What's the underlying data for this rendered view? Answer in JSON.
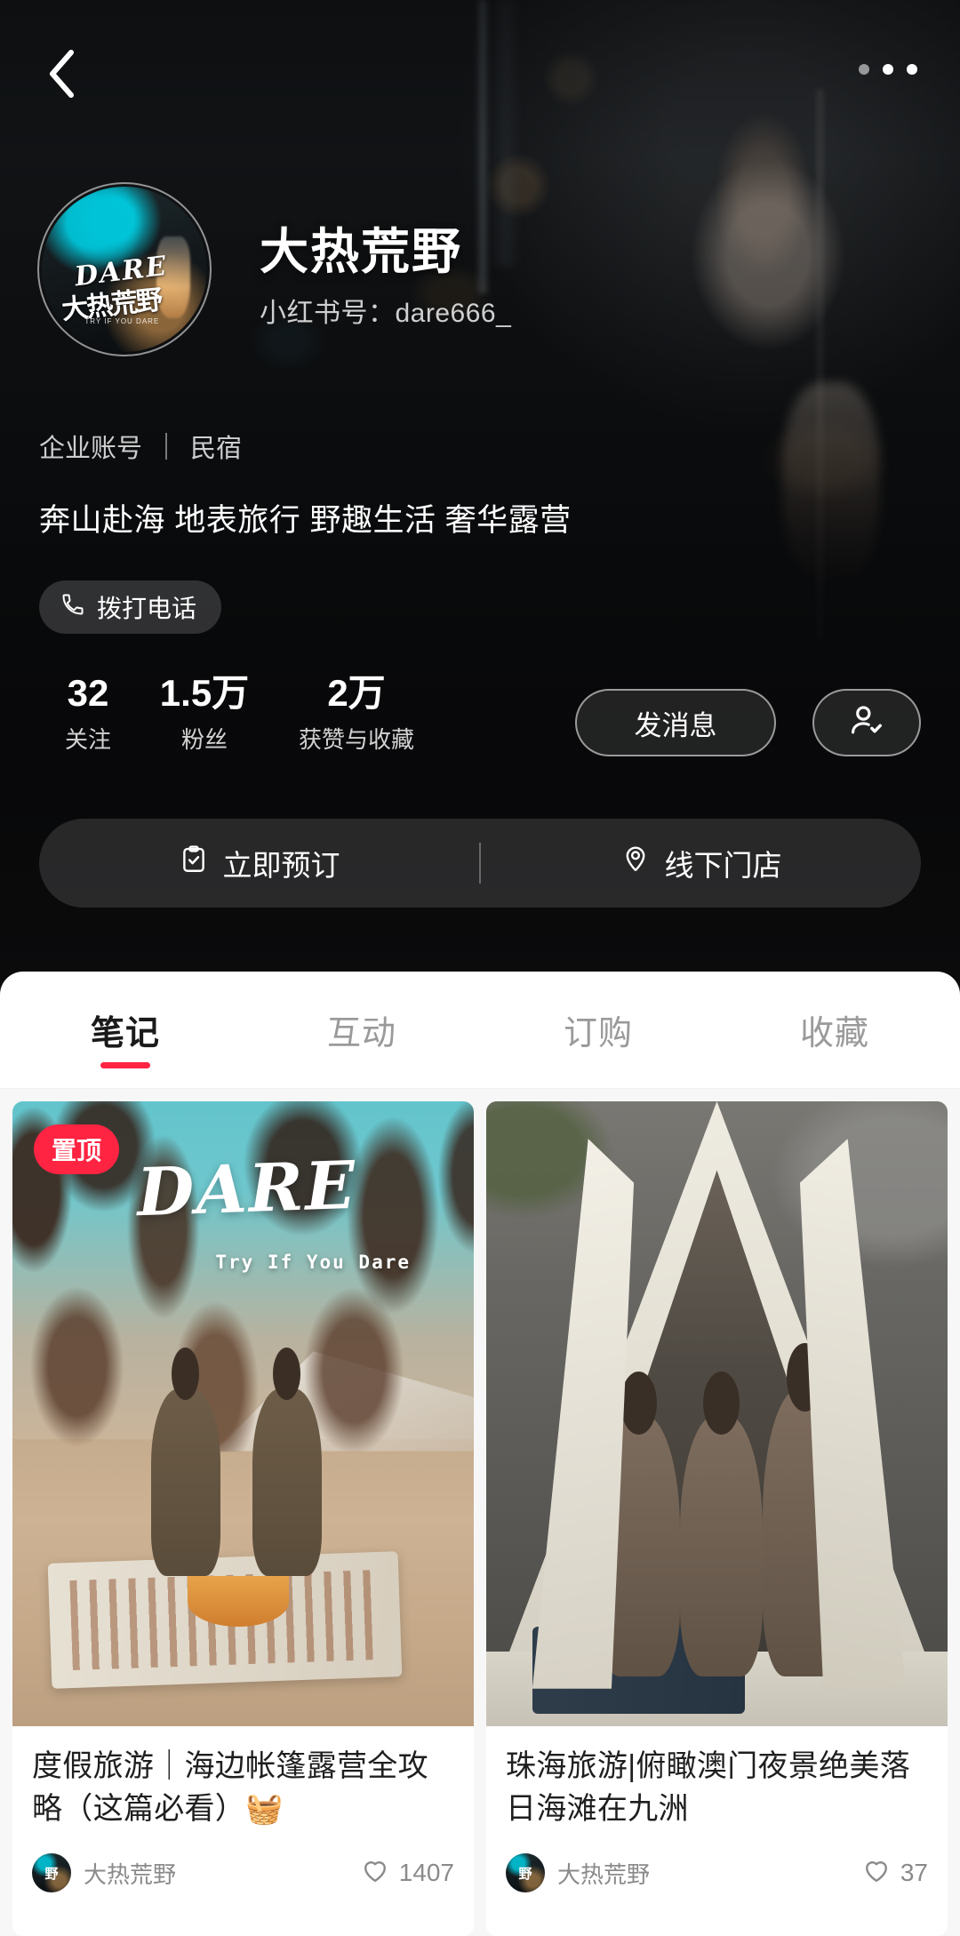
{
  "topbar": {
    "back_icon": "chevron-left-icon",
    "more_icon": "more-dots-icon"
  },
  "profile": {
    "avatar_alt": "DARE 大热荒野 logo",
    "avatar_logo_en": "DARE",
    "avatar_logo_cn": "大热荒野",
    "avatar_logo_tag": "TRY IF YOU DARE",
    "name": "大热荒野",
    "rednote_id_label": "小红书号：",
    "rednote_id_value": "dare666_",
    "account_type": "企业账号",
    "category": "民宿",
    "description": "奔山赴海 地表旅行 野趣生活 奢华露营",
    "call_button": {
      "label": "拨打电话",
      "icon": "phone-icon"
    }
  },
  "stats": [
    {
      "value": "32",
      "label": "关注"
    },
    {
      "value": "1.5万",
      "label": "粉丝"
    },
    {
      "value": "2万",
      "label": "获赞与收藏"
    }
  ],
  "actions": {
    "message_label": "发消息",
    "follow_icon": "user-check-icon"
  },
  "actionbar": [
    {
      "label": "立即预订",
      "icon": "clipboard-check-icon"
    },
    {
      "label": "线下门店",
      "icon": "location-pin-icon"
    }
  ],
  "tabs": [
    {
      "label": "笔记",
      "active": true
    },
    {
      "label": "互动",
      "active": false
    },
    {
      "label": "订购",
      "active": false
    },
    {
      "label": "收藏",
      "active": false
    }
  ],
  "notes": [
    {
      "pinned_badge": "置顶",
      "cover_title": "DARE",
      "cover_subtitle": "Try If You Dare",
      "title": "度假旅游｜海边帐篷露营全攻略（这篇必看）🧺",
      "author": "大热荒野",
      "likes": "1407",
      "like_icon": "heart-icon"
    },
    {
      "title": "珠海旅游|俯瞰澳门夜景绝美落日海滩在九洲",
      "author": "大热荒野",
      "likes": "37",
      "like_icon": "heart-icon"
    }
  ],
  "colors": {
    "accent_red": "#ff2442",
    "tab_active": "#1a1a1a",
    "tab_inactive": "#9a9a9a"
  }
}
